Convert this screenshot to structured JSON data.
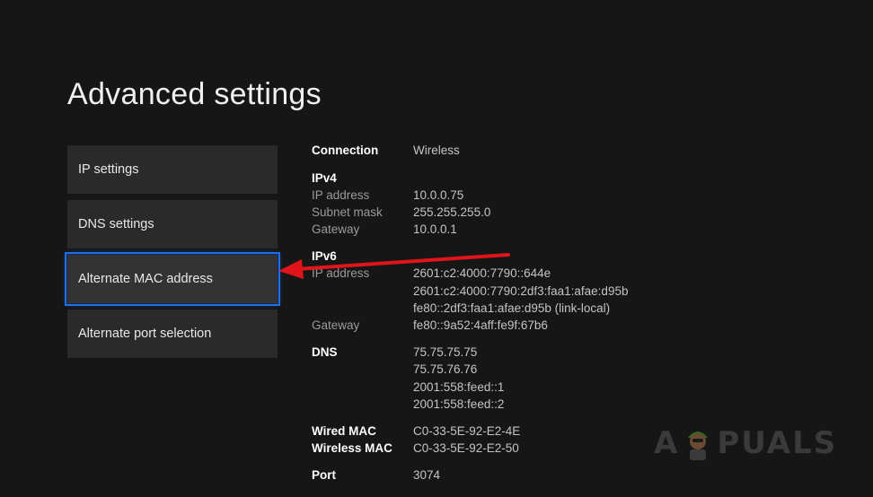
{
  "page": {
    "title": "Advanced settings"
  },
  "menu": {
    "items": [
      {
        "label": "IP settings"
      },
      {
        "label": "DNS settings"
      },
      {
        "label": "Alternate MAC address"
      },
      {
        "label": "Alternate port selection"
      }
    ]
  },
  "info": {
    "connection_label": "Connection",
    "connection_value": "Wireless",
    "ipv4_header": "IPv4",
    "ip_address_label": "IP address",
    "ip_address_value": "10.0.0.75",
    "subnet_label": "Subnet mask",
    "subnet_value": "255.255.255.0",
    "gateway4_label": "Gateway",
    "gateway4_value": "10.0.0.1",
    "ipv6_header": "IPv6",
    "ipv6_address_label": "IP address",
    "ipv6_addresses": [
      "2601:c2:4000:7790::644e",
      "2601:c2:4000:7790:2df3:faa1:afae:d95b",
      "fe80::2df3:faa1:afae:d95b (link-local)"
    ],
    "gateway6_label": "Gateway",
    "gateway6_value": "fe80::9a52:4aff:fe9f:67b6",
    "dns_label": "DNS",
    "dns_values": [
      "75.75.75.75",
      "75.75.76.76",
      "2001:558:feed::1",
      "2001:558:feed::2"
    ],
    "wired_mac_label": "Wired MAC",
    "wired_mac_value": "C0-33-5E-92-E2-4E",
    "wireless_mac_label": "Wireless MAC",
    "wireless_mac_value": "C0-33-5E-92-E2-50",
    "port_label": "Port",
    "port_value": "3074"
  },
  "watermark": {
    "text_left": "A",
    "text_right": "PUALS"
  },
  "colors": {
    "background": "#161616",
    "tile": "#2a2a2a",
    "focus": "#1f6fe8",
    "arrow": "#e0141b"
  }
}
